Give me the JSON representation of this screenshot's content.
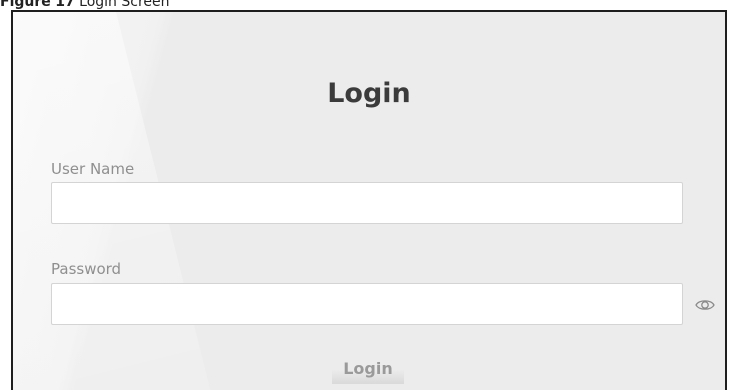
{
  "caption": {
    "figure_label": "Figure",
    "figure_number": "17",
    "text": "Login Screen"
  },
  "login_form": {
    "title": "Login",
    "username": {
      "label": "User Name",
      "value": "",
      "placeholder": ""
    },
    "password": {
      "label": "Password",
      "value": "",
      "placeholder": "",
      "toggle_icon": "eye-icon"
    },
    "submit_label": "Login"
  },
  "colors": {
    "panel_background": "#ececec",
    "title_text": "#3b3b3b",
    "label_text": "#8f8f8f",
    "input_background": "#ffffff",
    "input_border": "#d4d4d4",
    "button_text": "#9a9a9a"
  }
}
